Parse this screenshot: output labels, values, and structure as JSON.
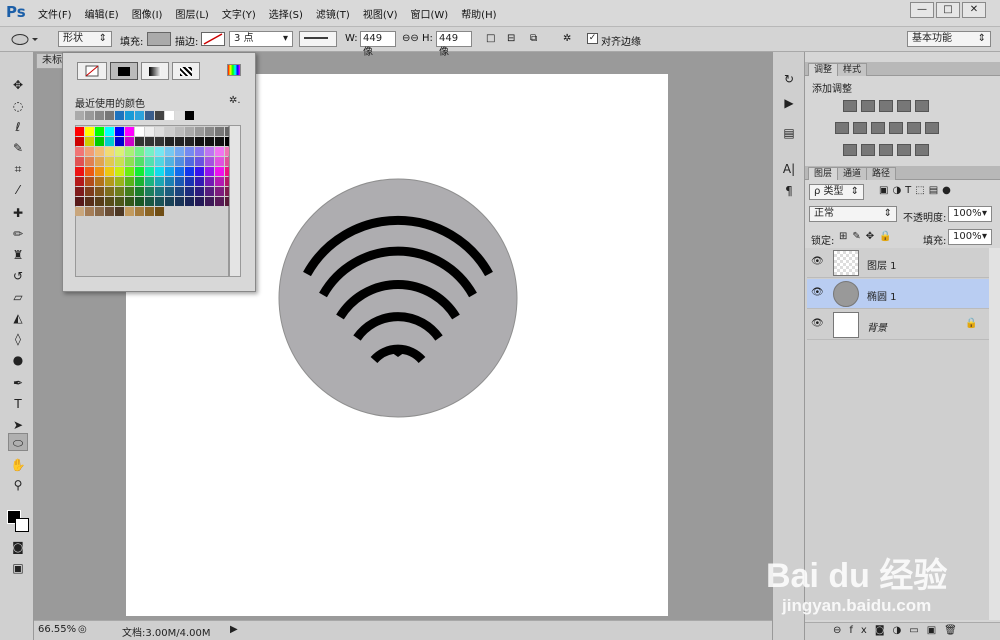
{
  "app": {
    "logo": "Ps"
  },
  "menus": [
    "文件(F)",
    "编辑(E)",
    "图像(I)",
    "图层(L)",
    "文字(Y)",
    "选择(S)",
    "滤镜(T)",
    "视图(V)",
    "窗口(W)",
    "帮助(H)"
  ],
  "window_controls": {
    "minimize": "—",
    "restore": "□",
    "close": "✕"
  },
  "options": {
    "mode": "形状",
    "fill_label": "填充:",
    "stroke_label": "描边:",
    "stroke_width": "3 点",
    "w_label": "W:",
    "w_value": "449 像",
    "h_label": "H:",
    "h_value": "449 像",
    "align_label": "对齐边缘",
    "workspace": "基本功能"
  },
  "document": {
    "tab": "未标"
  },
  "popup": {
    "recent_label": "最近使用的颜色",
    "gear": "✲."
  },
  "status": {
    "zoom": "66.55%",
    "doc": "文档:3.00M/4.00M"
  },
  "adjustments": {
    "tab1": "调整",
    "tab2": "样式",
    "title": "添加调整"
  },
  "layers": {
    "tab1": "图层",
    "tab2": "通道",
    "tab3": "路径",
    "filter": "ρ 类型",
    "blend": "正常",
    "opacity_label": "不透明度:",
    "opacity": "100%",
    "lock_label": "锁定:",
    "fill_label": "填充:",
    "fill": "100%",
    "items": [
      {
        "name": "图层 1"
      },
      {
        "name": "椭圆 1"
      },
      {
        "name": "背景"
      }
    ]
  },
  "watermark": {
    "brand": "Bai du 经验",
    "url": "jingyan.baidu.com"
  },
  "colors": {
    "accent": "#1c5fa8",
    "selected_layer": "#b9cdf2",
    "circle": "#aeadb0"
  }
}
